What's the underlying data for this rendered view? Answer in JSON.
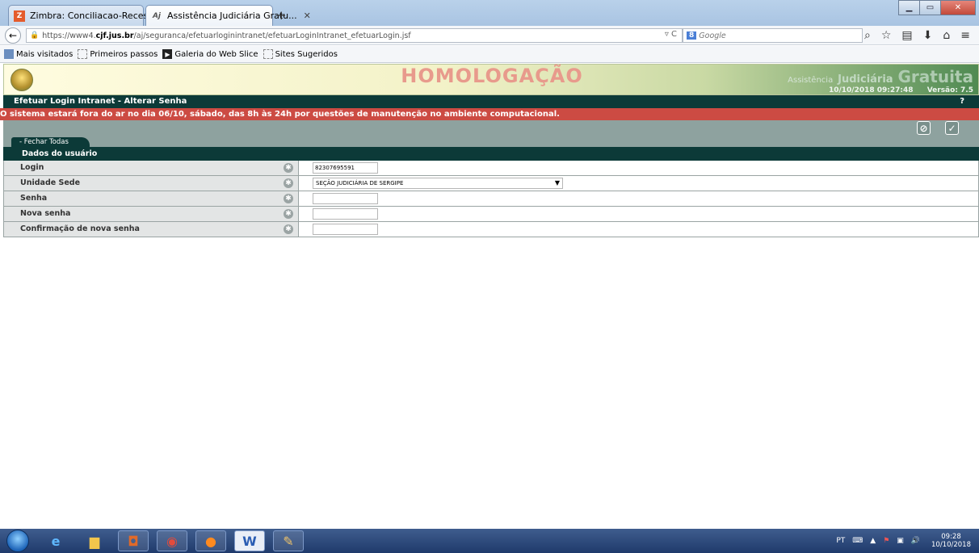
{
  "browser": {
    "tabs": [
      {
        "title": "Zimbra: Conciliacao-Reces...",
        "favicon": "zimbra-icon"
      },
      {
        "title": "Assistência Judiciária Gratu...",
        "favicon": "aj-icon"
      }
    ],
    "new_tab": "+",
    "url_prefix": "https://www4.",
    "url_domain": "cjf.jus.br",
    "url_path": "/aj/seguranca/efetuarloginintranet/efetuarLoginIntranet_efetuarLogin.jsf",
    "search_placeholder": "Google",
    "search_engine_badge": "8",
    "bookmarks": [
      "Mais visitados",
      "Primeiros passos",
      "Galeria do Web Slice",
      "Sites Sugeridos"
    ]
  },
  "app": {
    "environment_banner": "HOMOLOGAÇÃO",
    "brand_1": "Assistência",
    "brand_2": "Judiciária",
    "brand_3": "Gratuita",
    "datetime": "10/10/2018 09:27:48",
    "version": "Versão: 7.5",
    "page_title": "Efetuar Login Intranet - Alterar Senha",
    "help": "?",
    "alert": "O sistema estará fora do ar no dia 06/10, sábado, das 8h às 24h por questões de manutenção no ambiente computacional.",
    "close_all": "- Fechar Todas",
    "section_title": "Dados do usuário",
    "fields": [
      {
        "label": "Login",
        "value": "82307695591"
      },
      {
        "label": "Unidade Sede",
        "value": "SEÇÃO JUDICIÁRIA DE SERGIPE"
      },
      {
        "label": "Senha",
        "value": ""
      },
      {
        "label": "Nova senha",
        "value": ""
      },
      {
        "label": "Confirmação de nova senha",
        "value": ""
      }
    ]
  },
  "taskbar": {
    "language": "PT",
    "time": "09:28",
    "date": "10/10/2018"
  }
}
